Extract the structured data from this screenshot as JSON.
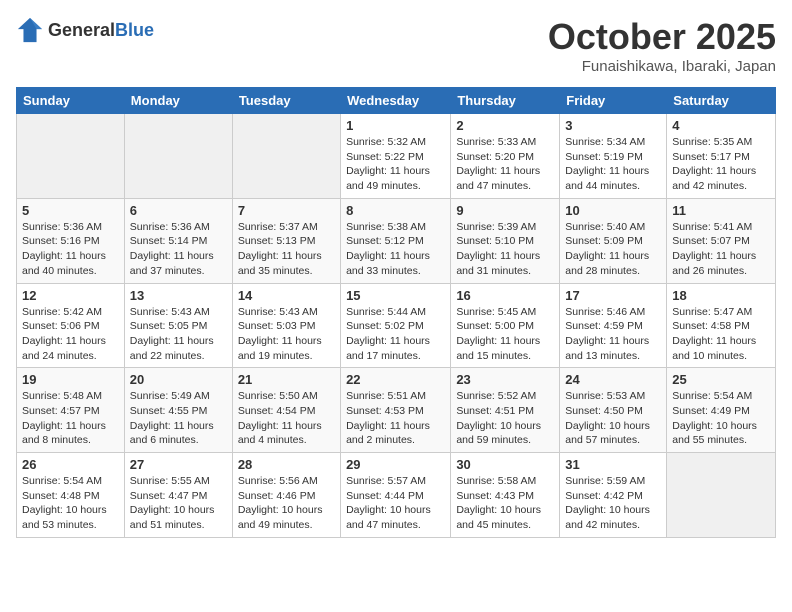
{
  "header": {
    "logo_general": "General",
    "logo_blue": "Blue",
    "month_title": "October 2025",
    "location": "Funaishikawa, Ibaraki, Japan"
  },
  "days_of_week": [
    "Sunday",
    "Monday",
    "Tuesday",
    "Wednesday",
    "Thursday",
    "Friday",
    "Saturday"
  ],
  "weeks": [
    [
      {
        "day": "",
        "info": ""
      },
      {
        "day": "",
        "info": ""
      },
      {
        "day": "",
        "info": ""
      },
      {
        "day": "1",
        "info": "Sunrise: 5:32 AM\nSunset: 5:22 PM\nDaylight: 11 hours\nand 49 minutes."
      },
      {
        "day": "2",
        "info": "Sunrise: 5:33 AM\nSunset: 5:20 PM\nDaylight: 11 hours\nand 47 minutes."
      },
      {
        "day": "3",
        "info": "Sunrise: 5:34 AM\nSunset: 5:19 PM\nDaylight: 11 hours\nand 44 minutes."
      },
      {
        "day": "4",
        "info": "Sunrise: 5:35 AM\nSunset: 5:17 PM\nDaylight: 11 hours\nand 42 minutes."
      }
    ],
    [
      {
        "day": "5",
        "info": "Sunrise: 5:36 AM\nSunset: 5:16 PM\nDaylight: 11 hours\nand 40 minutes."
      },
      {
        "day": "6",
        "info": "Sunrise: 5:36 AM\nSunset: 5:14 PM\nDaylight: 11 hours\nand 37 minutes."
      },
      {
        "day": "7",
        "info": "Sunrise: 5:37 AM\nSunset: 5:13 PM\nDaylight: 11 hours\nand 35 minutes."
      },
      {
        "day": "8",
        "info": "Sunrise: 5:38 AM\nSunset: 5:12 PM\nDaylight: 11 hours\nand 33 minutes."
      },
      {
        "day": "9",
        "info": "Sunrise: 5:39 AM\nSunset: 5:10 PM\nDaylight: 11 hours\nand 31 minutes."
      },
      {
        "day": "10",
        "info": "Sunrise: 5:40 AM\nSunset: 5:09 PM\nDaylight: 11 hours\nand 28 minutes."
      },
      {
        "day": "11",
        "info": "Sunrise: 5:41 AM\nSunset: 5:07 PM\nDaylight: 11 hours\nand 26 minutes."
      }
    ],
    [
      {
        "day": "12",
        "info": "Sunrise: 5:42 AM\nSunset: 5:06 PM\nDaylight: 11 hours\nand 24 minutes."
      },
      {
        "day": "13",
        "info": "Sunrise: 5:43 AM\nSunset: 5:05 PM\nDaylight: 11 hours\nand 22 minutes."
      },
      {
        "day": "14",
        "info": "Sunrise: 5:43 AM\nSunset: 5:03 PM\nDaylight: 11 hours\nand 19 minutes."
      },
      {
        "day": "15",
        "info": "Sunrise: 5:44 AM\nSunset: 5:02 PM\nDaylight: 11 hours\nand 17 minutes."
      },
      {
        "day": "16",
        "info": "Sunrise: 5:45 AM\nSunset: 5:00 PM\nDaylight: 11 hours\nand 15 minutes."
      },
      {
        "day": "17",
        "info": "Sunrise: 5:46 AM\nSunset: 4:59 PM\nDaylight: 11 hours\nand 13 minutes."
      },
      {
        "day": "18",
        "info": "Sunrise: 5:47 AM\nSunset: 4:58 PM\nDaylight: 11 hours\nand 10 minutes."
      }
    ],
    [
      {
        "day": "19",
        "info": "Sunrise: 5:48 AM\nSunset: 4:57 PM\nDaylight: 11 hours\nand 8 minutes."
      },
      {
        "day": "20",
        "info": "Sunrise: 5:49 AM\nSunset: 4:55 PM\nDaylight: 11 hours\nand 6 minutes."
      },
      {
        "day": "21",
        "info": "Sunrise: 5:50 AM\nSunset: 4:54 PM\nDaylight: 11 hours\nand 4 minutes."
      },
      {
        "day": "22",
        "info": "Sunrise: 5:51 AM\nSunset: 4:53 PM\nDaylight: 11 hours\nand 2 minutes."
      },
      {
        "day": "23",
        "info": "Sunrise: 5:52 AM\nSunset: 4:51 PM\nDaylight: 10 hours\nand 59 minutes."
      },
      {
        "day": "24",
        "info": "Sunrise: 5:53 AM\nSunset: 4:50 PM\nDaylight: 10 hours\nand 57 minutes."
      },
      {
        "day": "25",
        "info": "Sunrise: 5:54 AM\nSunset: 4:49 PM\nDaylight: 10 hours\nand 55 minutes."
      }
    ],
    [
      {
        "day": "26",
        "info": "Sunrise: 5:54 AM\nSunset: 4:48 PM\nDaylight: 10 hours\nand 53 minutes."
      },
      {
        "day": "27",
        "info": "Sunrise: 5:55 AM\nSunset: 4:47 PM\nDaylight: 10 hours\nand 51 minutes."
      },
      {
        "day": "28",
        "info": "Sunrise: 5:56 AM\nSunset: 4:46 PM\nDaylight: 10 hours\nand 49 minutes."
      },
      {
        "day": "29",
        "info": "Sunrise: 5:57 AM\nSunset: 4:44 PM\nDaylight: 10 hours\nand 47 minutes."
      },
      {
        "day": "30",
        "info": "Sunrise: 5:58 AM\nSunset: 4:43 PM\nDaylight: 10 hours\nand 45 minutes."
      },
      {
        "day": "31",
        "info": "Sunrise: 5:59 AM\nSunset: 4:42 PM\nDaylight: 10 hours\nand 42 minutes."
      },
      {
        "day": "",
        "info": ""
      }
    ]
  ]
}
